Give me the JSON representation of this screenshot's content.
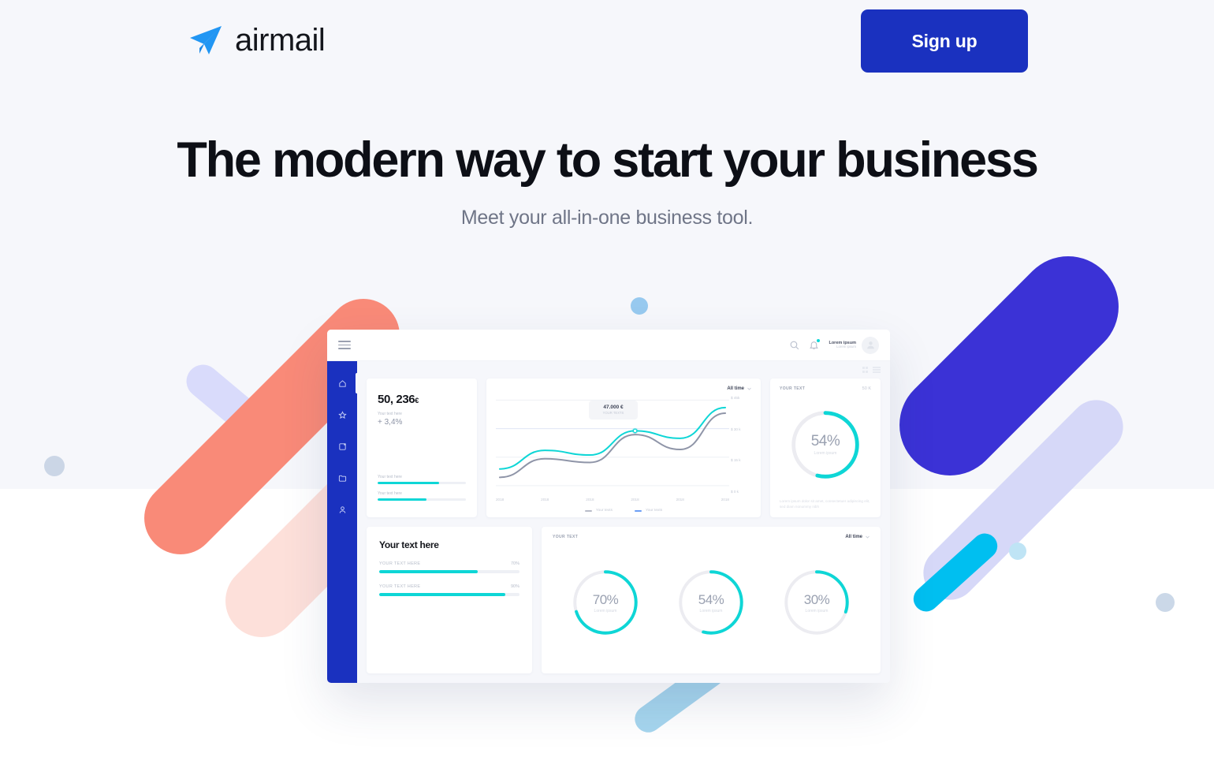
{
  "header": {
    "logo_text": "airmail",
    "logo_icon": "paper-plane-icon",
    "signup_label": "Sign up"
  },
  "hero": {
    "title": "The modern way to start your business",
    "subtitle": "Meet your all-in-one business tool."
  },
  "colors": {
    "brand_blue": "#1a31bf",
    "indigo": "#3b32d6",
    "cyan": "#0ed6d6",
    "coral": "#f98a78",
    "page_bg_top": "#f6f7fb",
    "page_bg_bottom": "#ffffff",
    "text_dark": "#0d0f16",
    "text_muted": "#6f7587"
  },
  "dashboard": {
    "topbar": {
      "menu_icon": "hamburger-icon",
      "search_icon": "search-icon",
      "bell_icon": "bell-icon",
      "user_name": "Lorem ipsum",
      "user_role": "Lorem ipsum",
      "avatar_icon": "avatar-icon"
    },
    "sidebar": [
      {
        "icon": "home-icon",
        "active": true
      },
      {
        "icon": "star-icon",
        "active": false
      },
      {
        "icon": "export-icon",
        "active": false
      },
      {
        "icon": "folder-icon",
        "active": false
      },
      {
        "icon": "user-icon",
        "active": false
      }
    ],
    "view_toggle": {
      "grid_icon": "grid-view-icon",
      "list_icon": "list-view-icon"
    },
    "stat_card": {
      "value": "50, 236",
      "currency": "€",
      "label": "Your text here",
      "delta": "+ 3,4%",
      "bars": [
        {
          "label": "Your text here",
          "percent": 70
        },
        {
          "label": "Your text here",
          "percent": 55
        }
      ]
    },
    "chart_card": {
      "range_label": "All time",
      "range_icon": "chevron-down-icon",
      "tooltip": {
        "value": "47.000 €",
        "label": "YOUR TEXTS"
      }
    },
    "donut_card": {
      "header": "YOUR TEXT",
      "amount": "50 K",
      "percent_label": "54%",
      "percent": 54,
      "sub": "Lorem ipsum",
      "note": "Lorem ipsum dolor sit amet, consectetuer adipiscing elit, sed diam nonummy nibh"
    },
    "progress_card": {
      "title": "Your text here",
      "rows": [
        {
          "label": "YOUR TEXT HERE",
          "value": "70%",
          "percent": 70
        },
        {
          "label": "YOUR TEXT HERE",
          "value": "90%",
          "percent": 90
        }
      ]
    },
    "donuts3_card": {
      "header": "YOUR TEXT",
      "range_label": "All time",
      "range_icon": "chevron-down-icon",
      "items": [
        {
          "percent_label": "70%",
          "percent": 70,
          "sub": "Lorem ipsum"
        },
        {
          "percent_label": "54%",
          "percent": 54,
          "sub": "Lorem ipsum"
        },
        {
          "percent_label": "30%",
          "percent": 30,
          "sub": "Lorem ipsum"
        }
      ]
    }
  },
  "chart_data": {
    "type": "line",
    "title": "",
    "xlabel": "",
    "ylabel": "",
    "grid": true,
    "legend_position": "bottom",
    "categories": [
      "2018",
      "2018",
      "2018",
      "2018",
      "2018",
      "2018"
    ],
    "ytick_labels": [
      "$ 45k",
      "$ 30 k",
      "$ 15 k",
      "$ 0 k"
    ],
    "ylim": [
      0,
      45000
    ],
    "series": [
      {
        "name": "Your texts",
        "color": "#0ed6d6",
        "values": [
          9000,
          19000,
          16500,
          29500,
          25500,
          42000
        ]
      },
      {
        "name": "Your texts",
        "color": "#8f95a8",
        "values": [
          4500,
          14500,
          12500,
          27500,
          19500,
          39000
        ]
      }
    ],
    "annotation": {
      "value": "47.000 €",
      "label": "YOUR TEXTS",
      "x_index": 3
    }
  }
}
